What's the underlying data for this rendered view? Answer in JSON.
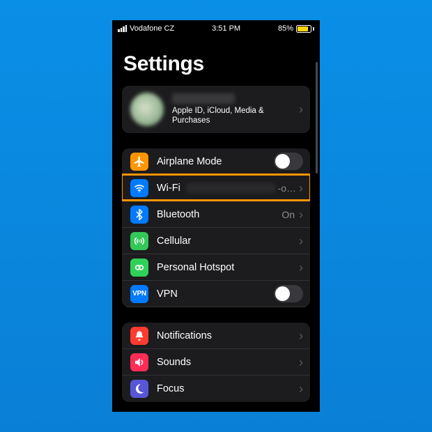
{
  "status": {
    "carrier": "Vodafone CZ",
    "time": "3:51 PM",
    "battery_pct": "85%"
  },
  "title": "Settings",
  "profile": {
    "subtitle": "Apple ID, iCloud, Media & Purchases"
  },
  "rows": {
    "airplane": "Airplane Mode",
    "wifi": "Wi-Fi",
    "wifi_value_suffix": "-o…",
    "bluetooth": "Bluetooth",
    "bluetooth_value": "On",
    "cellular": "Cellular",
    "hotspot": "Personal Hotspot",
    "vpn": "VPN",
    "notifications": "Notifications",
    "sounds": "Sounds",
    "focus": "Focus"
  }
}
